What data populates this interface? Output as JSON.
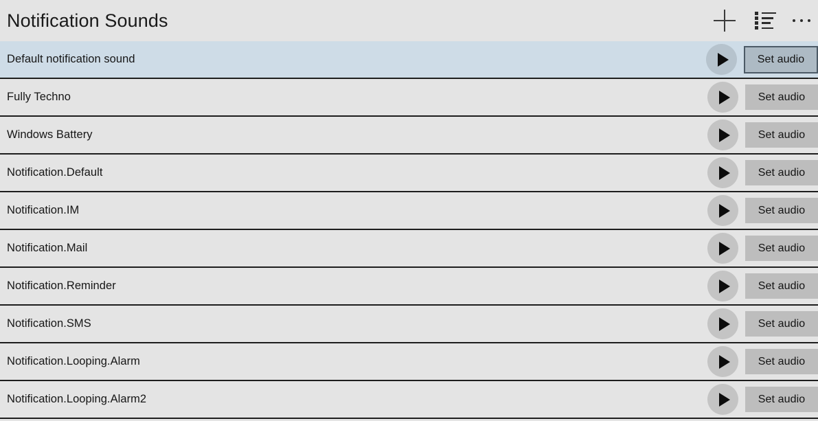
{
  "header": {
    "title": "Notification Sounds",
    "actions": [
      {
        "name": "add-button",
        "icon": "plus-icon",
        "label": "Add"
      },
      {
        "name": "select-list-button",
        "icon": "list-select-icon",
        "label": "Select"
      },
      {
        "name": "more-options-button",
        "icon": "ellipsis-icon",
        "label": "More"
      }
    ]
  },
  "list": {
    "play_label": "Play",
    "set_audio_label": "Set audio",
    "rows": [
      {
        "label": "Default notification sound",
        "selected": true
      },
      {
        "label": "Fully Techno",
        "selected": false
      },
      {
        "label": "Windows Battery",
        "selected": false
      },
      {
        "label": "Notification.Default",
        "selected": false
      },
      {
        "label": "Notification.IM",
        "selected": false
      },
      {
        "label": "Notification.Mail",
        "selected": false
      },
      {
        "label": "Notification.Reminder",
        "selected": false
      },
      {
        "label": "Notification.SMS",
        "selected": false
      },
      {
        "label": "Notification.Looping.Alarm",
        "selected": false
      },
      {
        "label": "Notification.Looping.Alarm2",
        "selected": false
      }
    ]
  },
  "colors": {
    "app_background": "#e4e4e4",
    "row_background": "#e4e4e4",
    "row_selected_background": "#cedce7",
    "row_separator": "#1d1d1d",
    "button_background": "#bdbdbd",
    "button_focus_border": "#4c5a66",
    "play_circle": "#c4c4c4",
    "text": "#161616"
  }
}
